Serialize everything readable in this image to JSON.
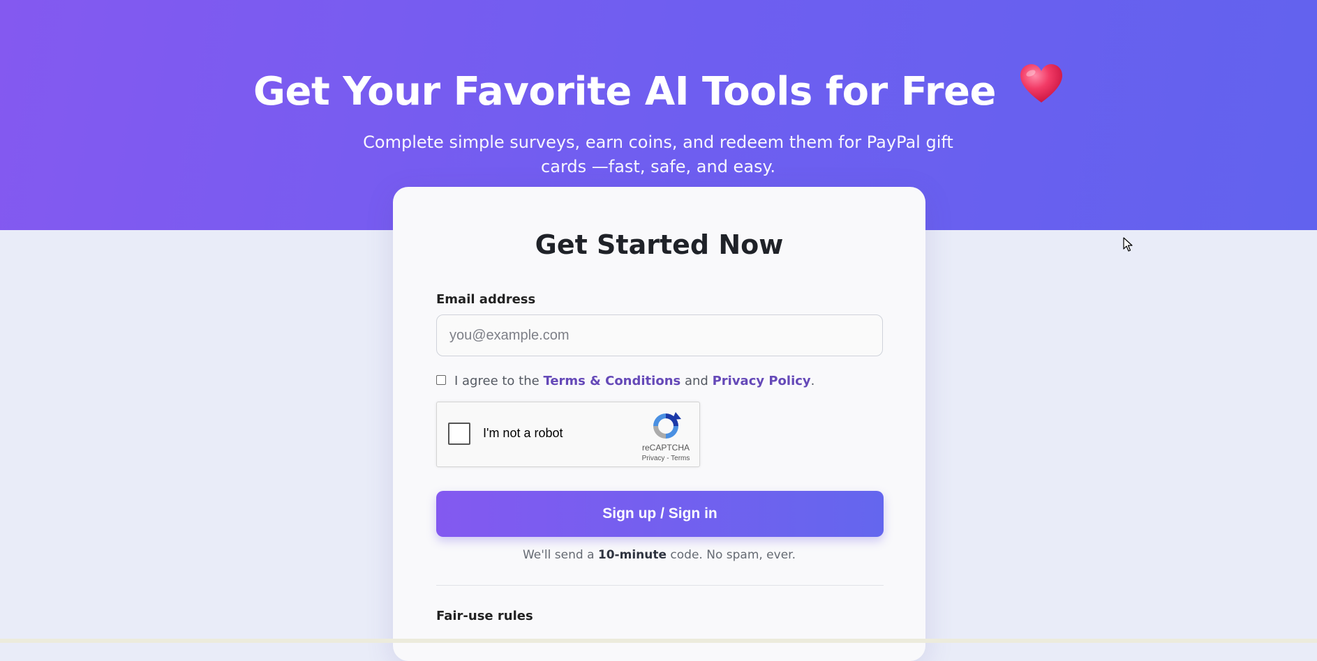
{
  "hero": {
    "title": "Get Your Favorite AI Tools for Free",
    "heart_icon": "heart-icon",
    "subtitle": "Complete simple surveys, earn coins, and redeem them for PayPal gift cards —fast, safe, and easy."
  },
  "card": {
    "title": "Get Started Now",
    "email_label": "Email address",
    "email_placeholder": "you@example.com",
    "email_value": "",
    "agree": {
      "prefix": "I agree to the",
      "terms_link": "Terms & Conditions",
      "middle": "and",
      "privacy_link": "Privacy Policy",
      "suffix": "."
    },
    "recaptcha": {
      "label": "I'm not a robot",
      "brand": "reCAPTCHA",
      "links": "Privacy - Terms"
    },
    "submit_label": "Sign up / Sign in",
    "note": {
      "prefix": "We'll send a",
      "strong": "10-minute",
      "suffix": "code. No spam, ever."
    },
    "fair_use_title": "Fair-use rules"
  },
  "colors": {
    "hero_gradient_start": "#8459f0",
    "hero_gradient_end": "#6262ee",
    "link": "#6549b8",
    "button_start": "#8359f0",
    "button_end": "#6466ee",
    "page_background": "#e9ecf8"
  }
}
